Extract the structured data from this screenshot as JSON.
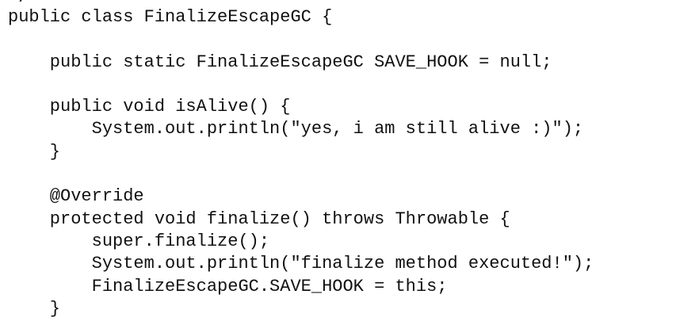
{
  "code": {
    "clipped_top_fragment": "*/",
    "lines": [
      "public class FinalizeEscapeGC {",
      "",
      "    public static FinalizeEscapeGC SAVE_HOOK = null;",
      "",
      "    public void isAlive() {",
      "        System.out.println(\"yes, i am still alive :)\");",
      "    }",
      "",
      "    @Override",
      "    protected void finalize() throws Throwable {",
      "        super.finalize();",
      "        System.out.println(\"finalize method executed!\");",
      "        FinalizeEscapeGC.SAVE_HOOK = this;",
      "    }"
    ]
  }
}
